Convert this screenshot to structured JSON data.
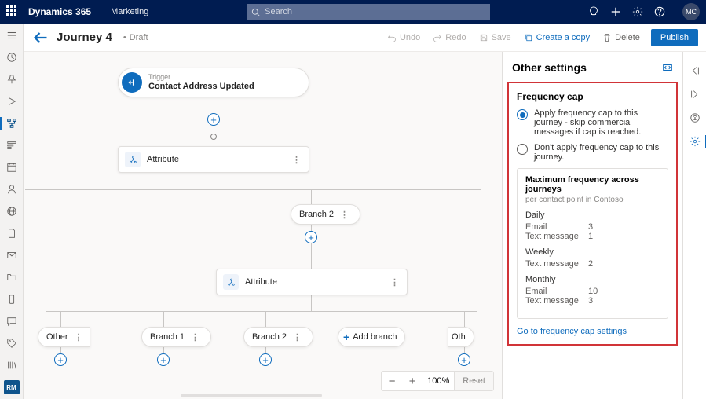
{
  "topbar": {
    "brand": "Dynamics 365",
    "module": "Marketing",
    "search_placeholder": "Search",
    "avatar": "MC"
  },
  "header": {
    "title": "Journey 4",
    "status": "Draft",
    "undo": "Undo",
    "redo": "Redo",
    "save": "Save",
    "copy": "Create a copy",
    "delete": "Delete",
    "publish": "Publish"
  },
  "canvas": {
    "trigger_label": "Trigger",
    "trigger_value": "Contact Address Updated",
    "attribute": "Attribute",
    "branch2": "Branch 2",
    "branch1": "Branch 1",
    "add_branch": "Add branch",
    "other": "Other",
    "other2": "Oth",
    "zoom": "100%",
    "reset": "Reset"
  },
  "panel": {
    "title": "Other settings",
    "section": "Frequency cap",
    "opt_apply": "Apply frequency cap to this journey - skip commercial messages if cap is reached.",
    "opt_skip": "Don't apply frequency cap to this journey.",
    "box_title": "Maximum frequency across journeys",
    "box_sub": "per contact point in Contoso",
    "daily": "Daily",
    "weekly": "Weekly",
    "monthly": "Monthly",
    "email": "Email",
    "text": "Text message",
    "v_daily_email": "3",
    "v_daily_text": "1",
    "v_weekly_text": "2",
    "v_monthly_email": "10",
    "v_monthly_text": "3",
    "link": "Go to frequency cap settings"
  },
  "leftnav_badge": "RM"
}
